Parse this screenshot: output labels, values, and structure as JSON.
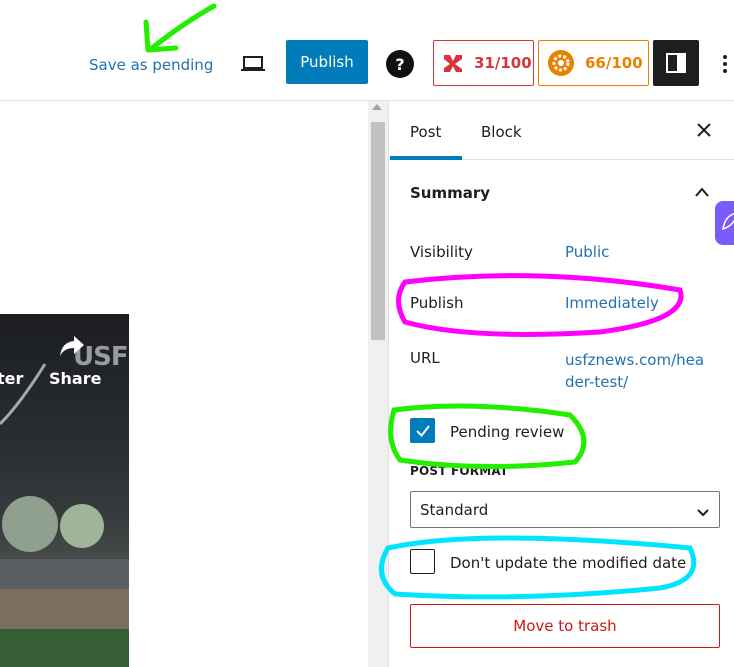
{
  "toolbar": {
    "save_pending_label": "Save as pending",
    "publish_label": "Publish",
    "help_label": "?",
    "score_m": "31/100",
    "score_s": "66/100"
  },
  "video": {
    "partial_text": "ter",
    "share_label": "Share",
    "logo_text": "USF"
  },
  "sidebar": {
    "tabs": [
      {
        "label": "Post",
        "active": true
      },
      {
        "label": "Block",
        "active": false
      }
    ],
    "summary_title": "Summary",
    "visibility": {
      "label": "Visibility",
      "value": "Public"
    },
    "publish": {
      "label": "Publish",
      "value": "Immediately"
    },
    "url": {
      "label": "URL",
      "value_line1": "usfznews.com/hea",
      "value_line2": "der-test/"
    },
    "pending_review": {
      "label": "Pending review",
      "checked": true
    },
    "post_format": {
      "label": "POST FORMAT",
      "value": "Standard"
    },
    "dont_update": {
      "label": "Don't update the modified date",
      "checked": false
    },
    "trash_label": "Move to trash"
  },
  "colors": {
    "accent": "#007cba",
    "link": "#2271b1",
    "danger": "#cc1818",
    "annot_green": "#22ee00",
    "annot_magenta": "#ff00ff",
    "annot_cyan": "#00e5ff"
  }
}
